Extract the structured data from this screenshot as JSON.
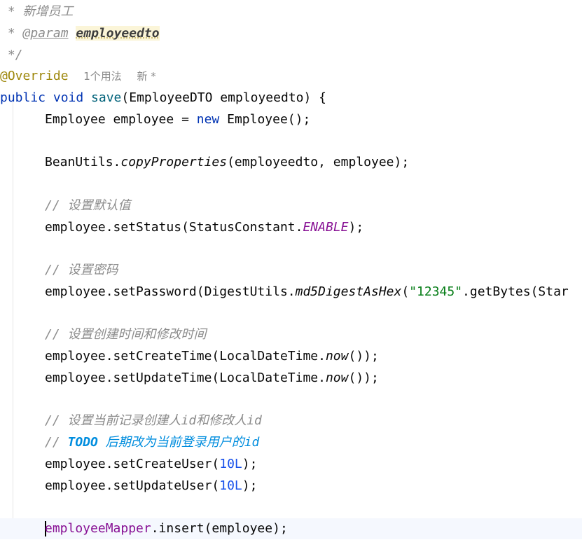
{
  "editor": {
    "doc_star_1": " * ",
    "doc_desc": "新增员工",
    "doc_star_2": " * ",
    "doc_param_tag": "@param",
    "doc_space": " ",
    "doc_param_name": "employeedto",
    "doc_end": " */",
    "annotation": "@Override",
    "usage_hint": "1个用法",
    "author_hint": "新 *",
    "method": {
      "modifiers": "public void ",
      "name": "save",
      "params": "(EmployeeDTO employeedto) {"
    },
    "line_new": {
      "decl": "Employee employee = ",
      "kw_new": "new",
      "rest": " Employee();"
    },
    "line_copy": {
      "prefix": "BeanUtils.",
      "method": "copyProperties",
      "args": "(employeedto, employee);"
    },
    "comment_default": "// 设置默认值",
    "line_status": {
      "prefix": "employee.setStatus(StatusConstant.",
      "constant": "ENABLE",
      "suffix": ");"
    },
    "comment_password": "// 设置密码",
    "line_password": {
      "prefix": "employee.setPassword(DigestUtils.",
      "method": "md5DigestAsHex",
      "open": "(",
      "string": "\"12345\"",
      "suffix": ".getBytes(Star"
    },
    "comment_time": "// 设置创建时间和修改时间",
    "line_create_time": {
      "prefix": "employee.setCreateTime(LocalDateTime.",
      "method": "now",
      "suffix": "());"
    },
    "line_update_time": {
      "prefix": "employee.setUpdateTime(LocalDateTime.",
      "method": "now",
      "suffix": "());"
    },
    "comment_user": "// 设置当前记录创建人id和修改人id",
    "comment_todo": {
      "slashes": "// ",
      "keyword": "TODO",
      "text": " 后期改为当前登录用户的id"
    },
    "line_create_user": {
      "prefix": "employee.setCreateUser(",
      "number": "10L",
      "suffix": ");"
    },
    "line_update_user": {
      "prefix": "employee.setUpdateUser(",
      "number": "10L",
      "suffix": ");"
    },
    "line_insert": {
      "field": "employeeMapper",
      "rest": ".insert(employee);"
    }
  }
}
